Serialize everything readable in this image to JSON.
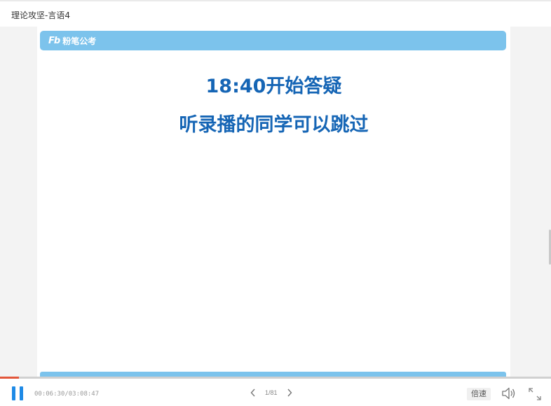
{
  "window": {
    "title": "理论攻坚-言语4"
  },
  "slide": {
    "brand_mark": "Fb",
    "brand_name": "粉笔公考",
    "headline_1": "18:40开始答疑",
    "headline_2": "听录播的同学可以跳过"
  },
  "player": {
    "time": "00:06:30/03:08:47",
    "progress": 0.034,
    "page": "1/81",
    "speed_label": "倍速"
  },
  "colors": {
    "accent": "#1e8ae6",
    "slide_bar": "#7cc3ec",
    "headline": "#1565b5",
    "progress": "#e2563a"
  },
  "icons": {
    "play_pause": "pause-icon",
    "prev": "chevron-left-icon",
    "next": "chevron-right-icon",
    "volume": "speaker-icon",
    "fullscreen": "expand-icon"
  }
}
